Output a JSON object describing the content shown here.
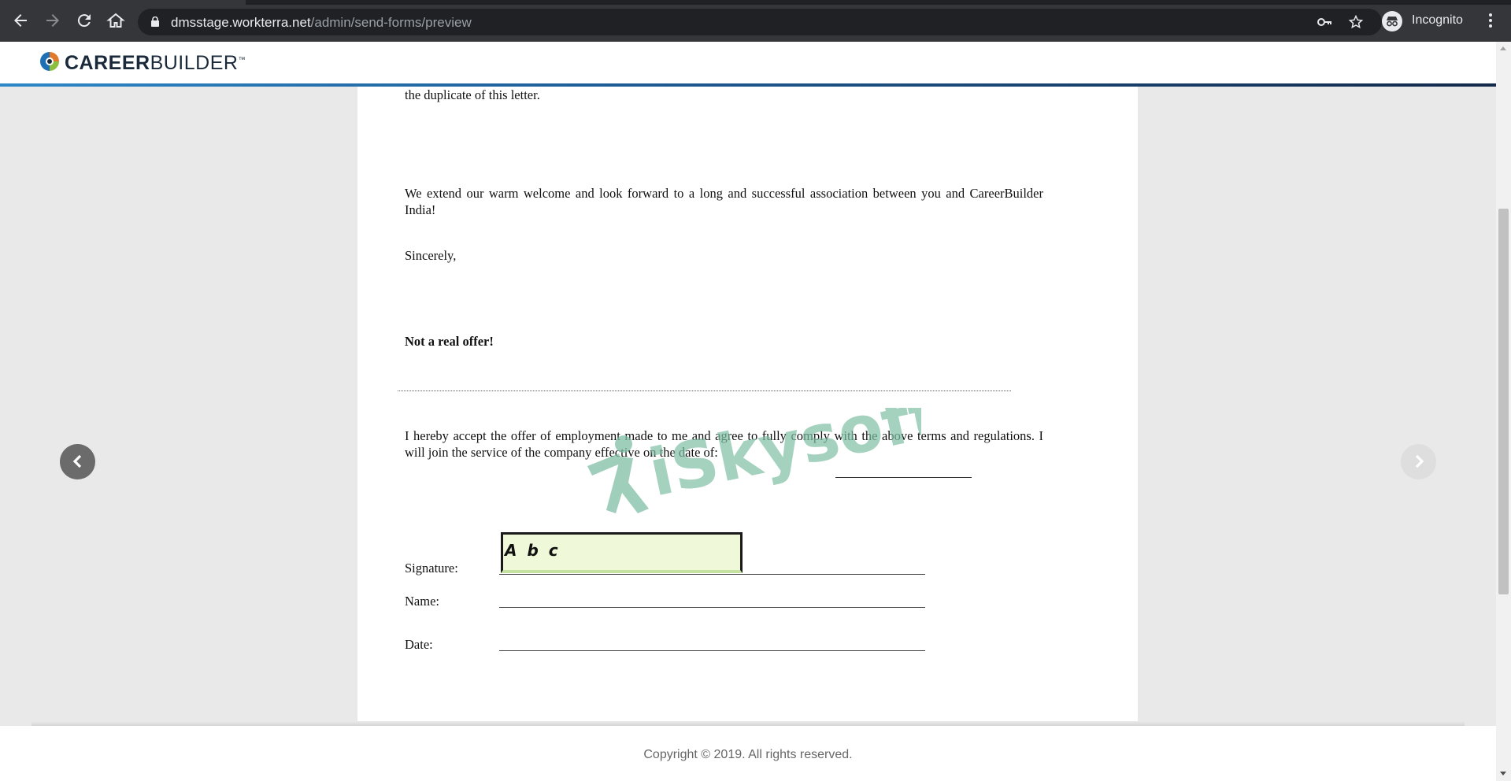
{
  "browser": {
    "url_host": "dmsstage.workterra.net",
    "url_path": "/admin/send-forms/preview",
    "profile_label": "Incognito",
    "icons": [
      "back-icon",
      "forward-icon",
      "reload-icon",
      "home-icon",
      "lock-icon",
      "key-icon",
      "star-icon",
      "incognito-icon",
      "menu-icon"
    ]
  },
  "header": {
    "logo_bold": "CAREER",
    "logo_light": "BUILDER",
    "logo_tm": "™"
  },
  "document": {
    "top_fragment": "the duplicate of this letter.",
    "welcome": "We extend our warm welcome and look forward to a long and successful association between you and CareerBuilder India!",
    "closing": "Sincerely,",
    "disclaimer": "Not a real offer!",
    "acceptance": "I hereby accept the offer of employment made to me and agree to fully comply with the above terms and regulations. I will join the service of the company effective on the date of:",
    "signature_label": "Signature:",
    "signature_value": "A b c",
    "name_label": "Name:",
    "date_label": "Date:"
  },
  "watermark": {
    "text": "iSkysoft"
  },
  "footer": {
    "copyright": "Copyright © 2019. All rights reserved."
  },
  "colors": {
    "chrome_bg": "#35363a",
    "omnibox_bg": "#202124",
    "page_bg": "#e9e9e9",
    "signature_fill": "#eff8d8",
    "watermark": "#7fbfa5"
  }
}
